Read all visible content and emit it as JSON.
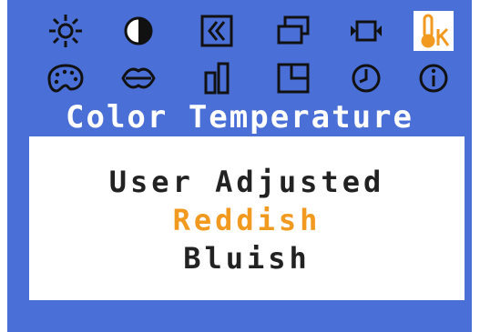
{
  "menu": {
    "title": "Color Temperature",
    "options": [
      "User Adjusted",
      "Reddish",
      "Bluish"
    ],
    "selected_option": "Reddish",
    "selected_icon": "color-temperature-icon"
  },
  "icons_row1": [
    "brightness-icon",
    "contrast-icon",
    "position-icon",
    "size-icon",
    "zoom-icon",
    "color-temperature-icon"
  ],
  "icons_row2": [
    "color-palette-icon",
    "sharpness-icon",
    "phase-icon",
    "osd-position-icon",
    "osd-timer-icon",
    "information-icon"
  ],
  "colors": {
    "osd_background": "#4a6fd6",
    "panel_background": "#ffffff",
    "highlight": "#f29a1f",
    "text": "#222222",
    "icon": "#111111"
  }
}
